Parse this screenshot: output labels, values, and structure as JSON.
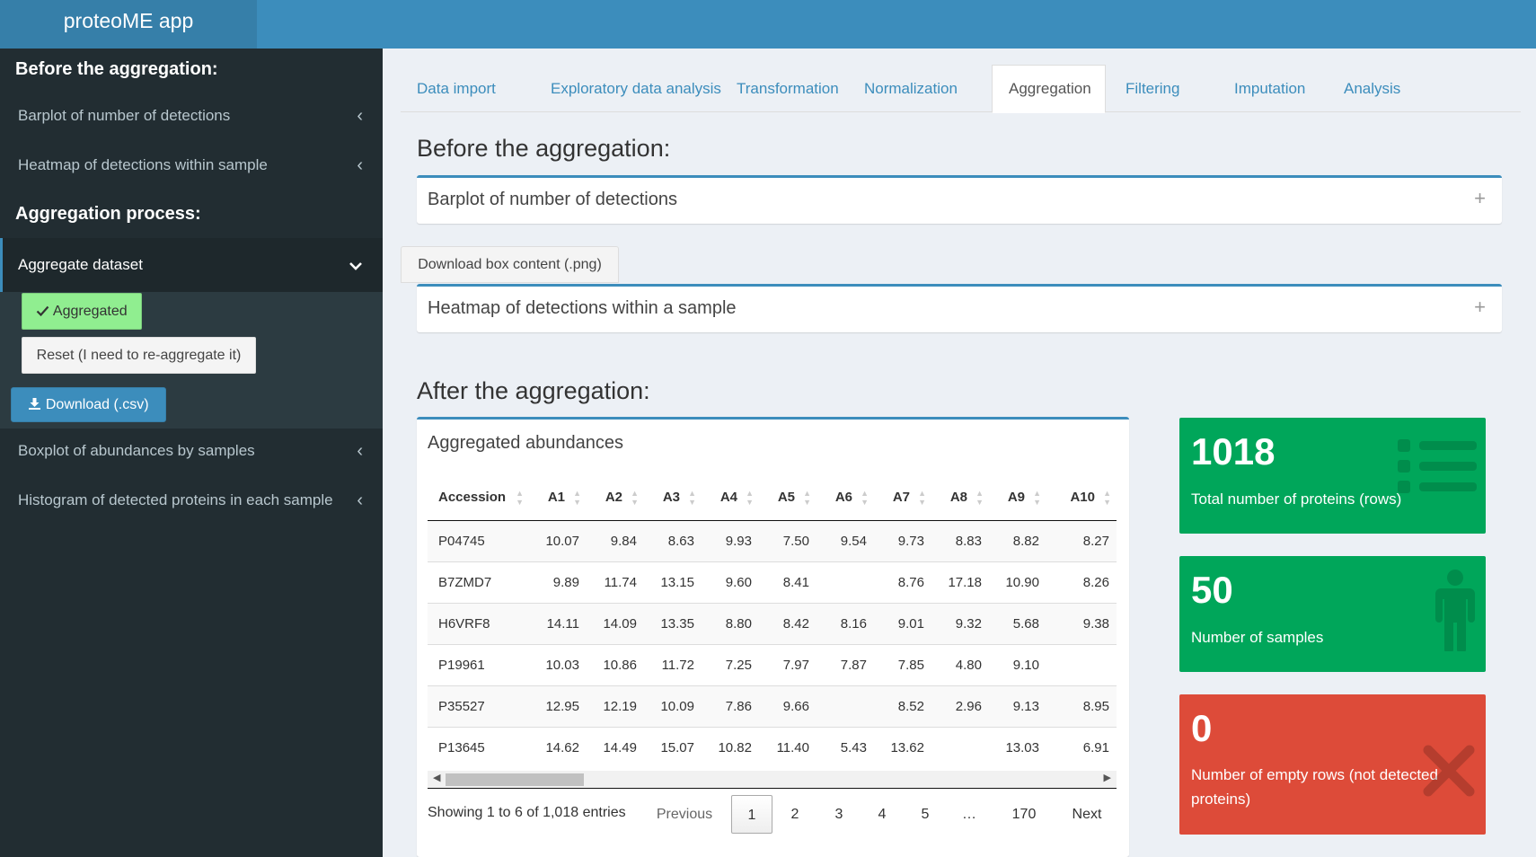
{
  "app": {
    "title": "proteoME app"
  },
  "sidebar": {
    "heading_before": "Before the aggregation:",
    "heading_process": "Aggregation process:",
    "items": [
      {
        "label": "Barplot of number of detections"
      },
      {
        "label": "Heatmap of detections within sample"
      },
      {
        "label": "Aggregate dataset"
      },
      {
        "label": "Boxplot of abundances by samples"
      },
      {
        "label": "Histogram of detected proteins in each sample"
      }
    ],
    "aggregated_label": "Aggregated",
    "reset_label": "Reset (I need to re-aggregate it)",
    "download_label": "Download (.csv)"
  },
  "tabs": [
    {
      "label": "Data import"
    },
    {
      "label": "Exploratory data analysis"
    },
    {
      "label": "Transformation"
    },
    {
      "label": "Normalization"
    },
    {
      "label": "Aggregation"
    },
    {
      "label": "Filtering"
    },
    {
      "label": "Imputation"
    },
    {
      "label": "Analysis"
    }
  ],
  "main": {
    "before_title": "Before the aggregation:",
    "barplot_box_title": "Barplot of number of detections",
    "download_box_label": "Download box content (.png)",
    "heatmap_box_title": "Heatmap of detections within a sample",
    "after_title": "After the aggregation:",
    "table_box_title": "Aggregated abundances"
  },
  "table": {
    "columns": [
      "Accession",
      "A1",
      "A2",
      "A3",
      "A4",
      "A5",
      "A6",
      "A7",
      "A8",
      "A9",
      "A10"
    ],
    "rows": [
      [
        "P04745",
        "10.07",
        "9.84",
        "8.63",
        "9.93",
        "7.50",
        "9.54",
        "9.73",
        "8.83",
        "8.82",
        "8.27"
      ],
      [
        "B7ZMD7",
        "9.89",
        "11.74",
        "13.15",
        "9.60",
        "8.41",
        "",
        "8.76",
        "17.18",
        "10.90",
        "8.26"
      ],
      [
        "H6VRF8",
        "14.11",
        "14.09",
        "13.35",
        "8.80",
        "8.42",
        "8.16",
        "9.01",
        "9.32",
        "5.68",
        "9.38"
      ],
      [
        "P19961",
        "10.03",
        "10.86",
        "11.72",
        "7.25",
        "7.97",
        "7.87",
        "7.85",
        "4.80",
        "9.10",
        ""
      ],
      [
        "P35527",
        "12.95",
        "12.19",
        "10.09",
        "7.86",
        "9.66",
        "",
        "8.52",
        "2.96",
        "9.13",
        "8.95"
      ],
      [
        "P13645",
        "14.62",
        "14.49",
        "15.07",
        "10.82",
        "11.40",
        "5.43",
        "13.62",
        "",
        "13.03",
        "6.91"
      ]
    ],
    "info": "Showing 1 to 6 of 1,018 entries",
    "pager": {
      "previous": "Previous",
      "pages": [
        "1",
        "2",
        "3",
        "4",
        "5",
        "…",
        "170"
      ],
      "next": "Next"
    }
  },
  "value_boxes": [
    {
      "value": "1018",
      "label": "Total number of proteins (rows)",
      "icon": "list-icon",
      "color": "#00a65a"
    },
    {
      "value": "50",
      "label": "Number of samples",
      "icon": "person-icon",
      "color": "#00a65a"
    },
    {
      "value": "0",
      "label": "Number of empty rows (not detected proteins)",
      "icon": "x-icon",
      "color": "#dd4b39"
    }
  ],
  "colors": {
    "header": "#3c8dbc",
    "brand": "#367fa9",
    "sidebar": "#222d32",
    "success": "#00a65a",
    "danger": "#dd4b39",
    "aggregated_button": "#90ee90"
  }
}
